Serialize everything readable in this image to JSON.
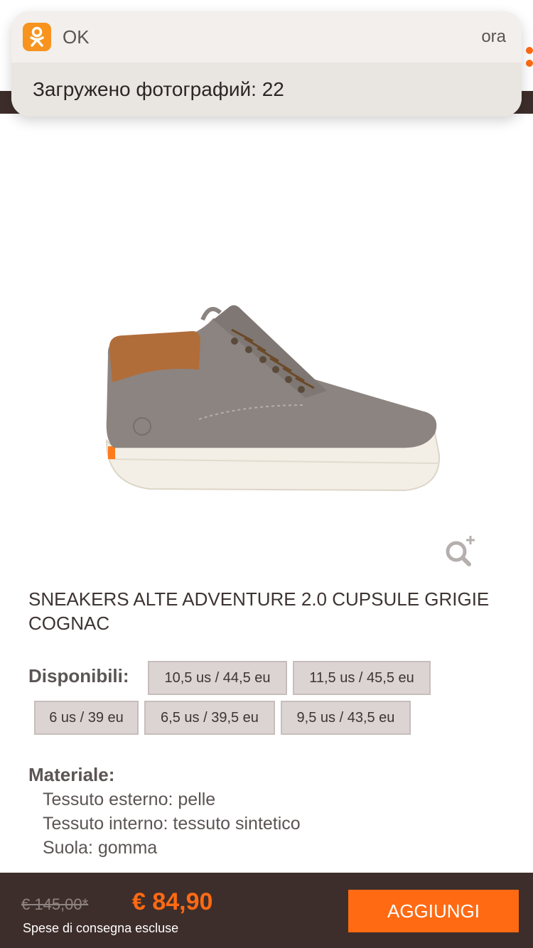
{
  "notification": {
    "app_name": "OK",
    "app_icon": "odnoklassniki-icon",
    "time": "ora",
    "message": "Загружено фотографий: 22"
  },
  "product": {
    "title": "SNEAKERS ALTE ADVENTURE 2.0 CUPSULE GRIGIE COGNAC",
    "image_icon": "shoe-image",
    "zoom_icon": "zoom-in-icon"
  },
  "sizes": {
    "label": "Disponibili:",
    "options": [
      "10,5 us / 44,5 eu",
      "11,5 us / 45,5 eu",
      "6 us / 39 eu",
      "6,5 us / 39,5 eu",
      "9,5 us / 43,5 eu"
    ]
  },
  "material": {
    "label": "Materiale:",
    "lines": [
      "Tessuto esterno: pelle",
      "Tessuto interno: tessuto sintetico",
      "Suola: gomma"
    ]
  },
  "purchase": {
    "old_price": "€ 145,00*",
    "price": "€ 84,90",
    "shipping_note": "Spese di consegna escluse",
    "add_label": "AGGIUNGI"
  },
  "colors": {
    "accent": "#ff6a13",
    "dark": "#3e2e2b",
    "chip": "#dcd4d3"
  }
}
